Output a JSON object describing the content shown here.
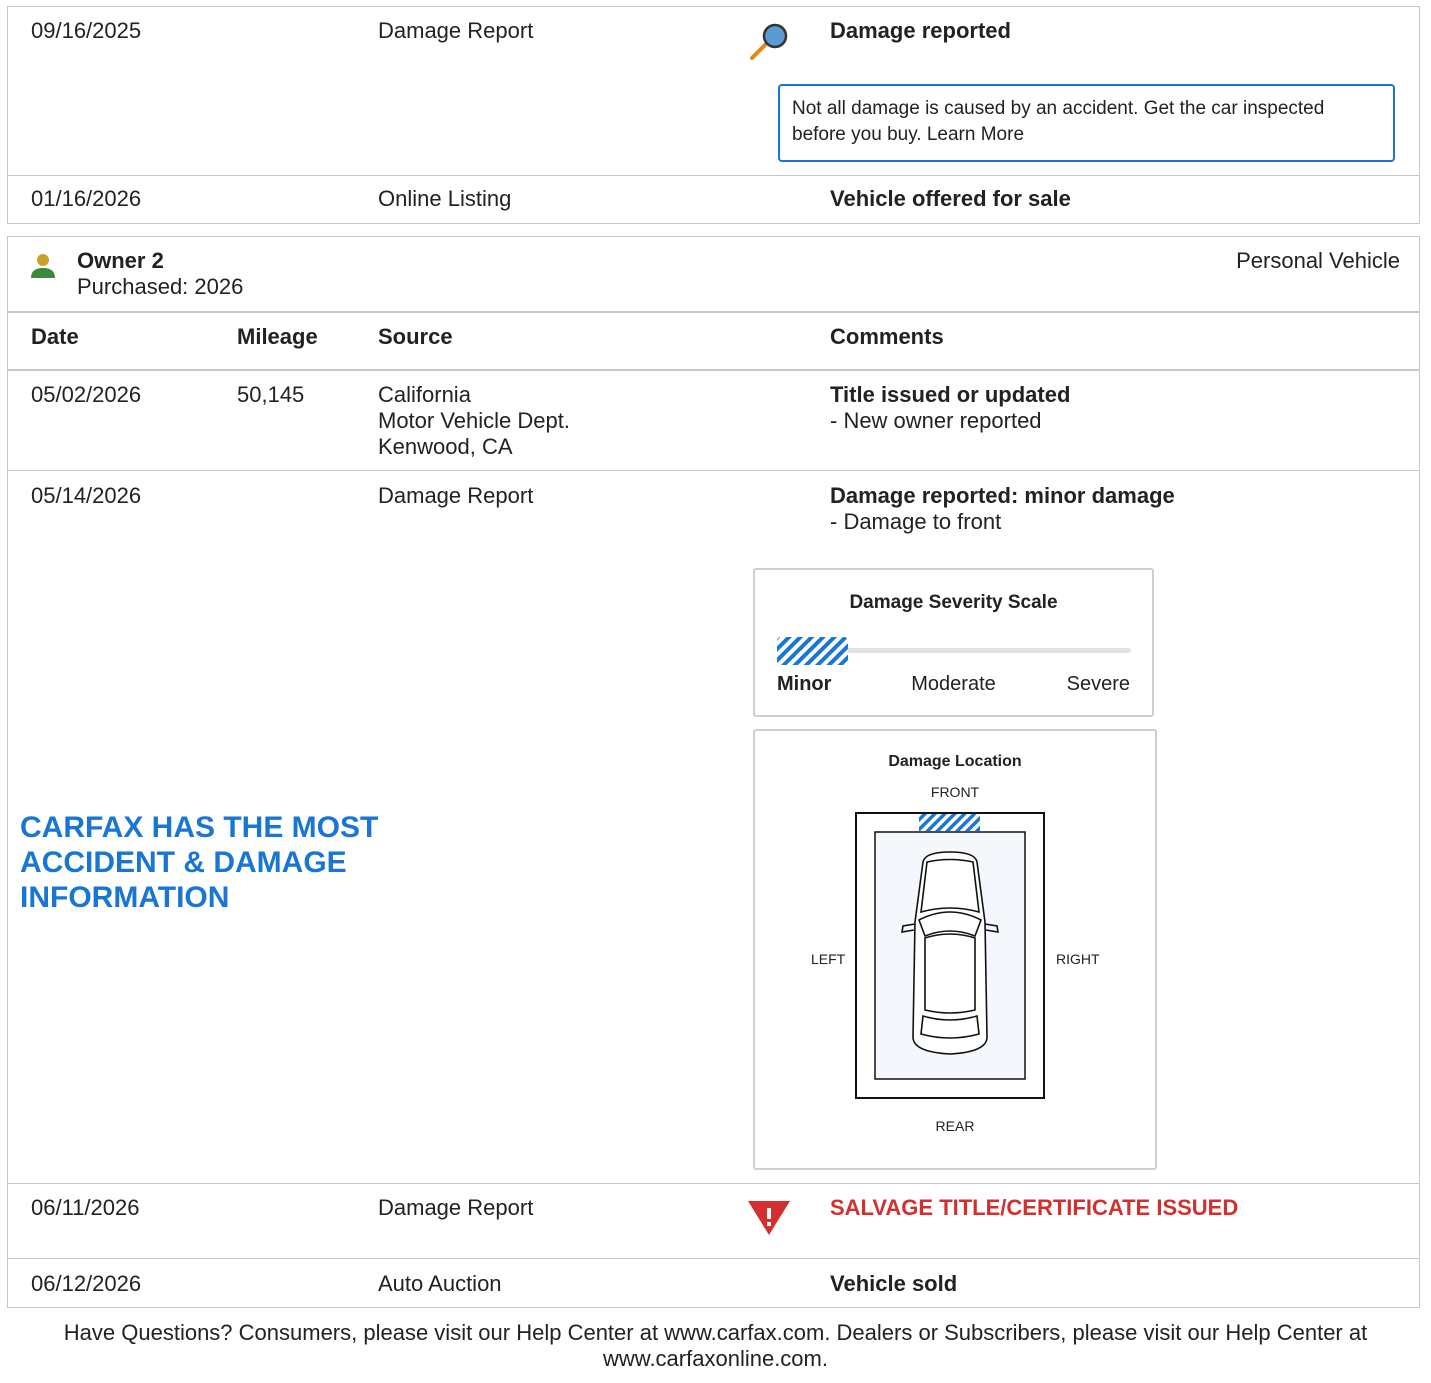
{
  "record1": {
    "date": "09/16/2025",
    "source": "Damage Report",
    "icon": "magnifier-icon",
    "comment": "Damage reported",
    "note": "Not all damage is caused by an accident. Get the car inspected before you buy. Learn More"
  },
  "record2": {
    "date": "01/16/2026",
    "source": "Online Listing",
    "comment": "Vehicle offered for sale"
  },
  "owner": {
    "name": "Owner 2",
    "purchased": "Purchased: 2026",
    "type": "Personal Vehicle",
    "icon": "person-icon"
  },
  "columns": {
    "date": "Date",
    "mileage": "Mileage",
    "source": "Source",
    "comments": "Comments"
  },
  "record3": {
    "date": "05/02/2026",
    "mileage": "50,145",
    "source_line1": "California",
    "source_line2": "Motor Vehicle Dept.",
    "source_line3": "Kenwood, CA",
    "comment": "Title issued or updated",
    "detail": "- New owner reported"
  },
  "record4": {
    "date": "05/14/2026",
    "source": "Damage Report",
    "comment": "Damage reported: minor damage",
    "detail": "- Damage to front",
    "severity": {
      "title": "Damage Severity Scale",
      "minor": "Minor",
      "moderate": "Moderate",
      "severe": "Severe",
      "level": "Minor"
    },
    "location": {
      "title": "Damage Location",
      "front": "FRONT",
      "rear": "REAR",
      "left": "LEFT",
      "right": "RIGHT",
      "damaged_side": "front"
    }
  },
  "promo": {
    "line1": "CARFAX HAS THE MOST",
    "line2": "ACCIDENT & DAMAGE",
    "line3": "INFORMATION"
  },
  "record5": {
    "date": "06/11/2026",
    "source": "Damage Report",
    "icon": "warning-icon",
    "comment": "SALVAGE TITLE/CERTIFICATE ISSUED"
  },
  "record6": {
    "date": "06/12/2026",
    "source": "Auto Auction",
    "comment": "Vehicle sold"
  },
  "footer": {
    "line1": "Have Questions? Consumers, please visit our Help Center at www.carfax.com. Dealers or Subscribers, please visit our Help Center at",
    "line2": "www.carfaxonline.com."
  },
  "colors": {
    "accent": "#1976d2",
    "alert": "#d32f2f",
    "border": "#c8c8c8"
  }
}
